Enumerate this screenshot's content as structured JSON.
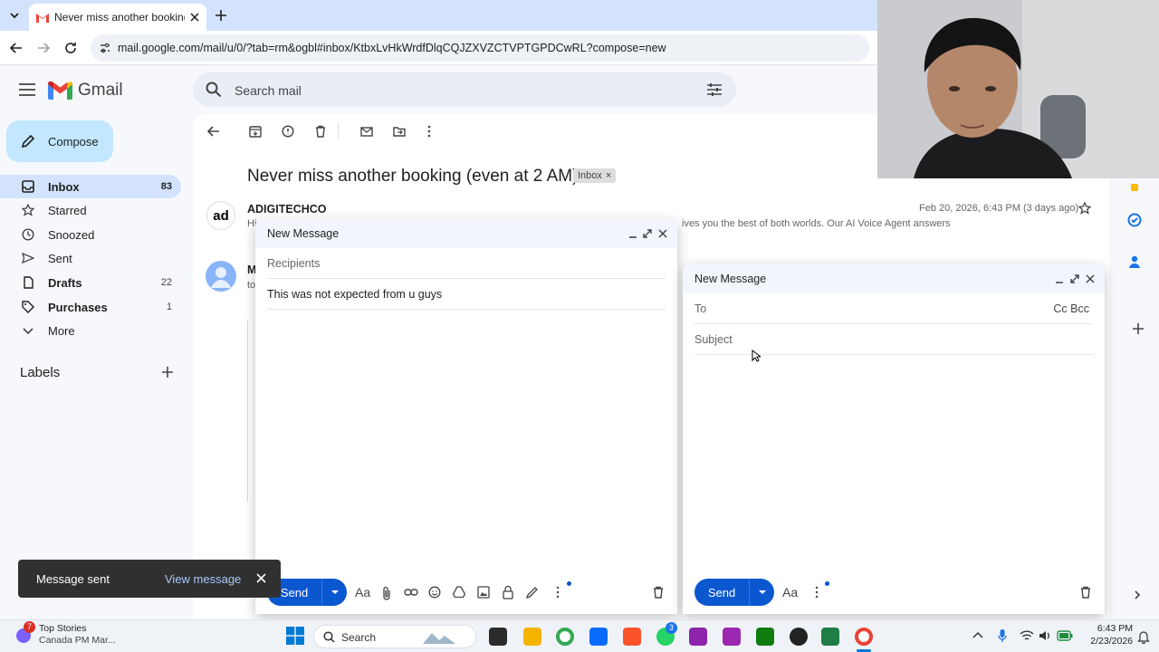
{
  "browser": {
    "tab_title": "Never miss another booking (e",
    "url": "mail.google.com/mail/u/0/?tab=rm&ogbl#inbox/KtbxLvHkWrdfDlqCQJZXVZCTVPTGPDCwRL?compose=new"
  },
  "gmail": {
    "brand": "Gmail",
    "search_placeholder": "Search mail",
    "compose_label": "Compose",
    "nav": [
      {
        "label": "Inbox",
        "count": "83",
        "icon": "inbox-icon"
      },
      {
        "label": "Starred",
        "count": "",
        "icon": "star-icon"
      },
      {
        "label": "Snoozed",
        "count": "",
        "icon": "clock-icon"
      },
      {
        "label": "Sent",
        "count": "",
        "icon": "send-icon"
      },
      {
        "label": "Drafts",
        "count": "22",
        "icon": "draft-icon"
      },
      {
        "label": "Purchases",
        "count": "1",
        "icon": "tag-icon"
      },
      {
        "label": "More",
        "count": "",
        "icon": "chevron-down-icon"
      }
    ],
    "labels_heading": "Labels",
    "email": {
      "subject": "Never miss another booking (even at 2 AM)",
      "label_chip": "Inbox",
      "sender": "ADIGITECHCO",
      "avatar_text": "ad",
      "date": "Feb 20, 2026, 6:43 PM (3 days ago)",
      "snippet_visible": "ives you the best of both worlds. Our AI Voice Agent answers",
      "snippet_start": "Hi",
      "second_sender_initial": "M",
      "second_to": "to"
    }
  },
  "compose1": {
    "title": "New Message",
    "recipients_placeholder": "Recipients",
    "subject_value": "This was not expected from u guys",
    "send_label": "Send"
  },
  "compose2": {
    "title": "New Message",
    "to_label": "To",
    "cc_bcc": "Cc Bcc",
    "subject_placeholder": "Subject",
    "send_label": "Send"
  },
  "toast": {
    "message": "Message sent",
    "action": "View message"
  },
  "taskbar": {
    "news_title": "Top Stories",
    "news_sub": "Canada PM Mar...",
    "news_badge": "7",
    "search_label": "Search",
    "time": "6:43 PM",
    "date": "2/23/2026",
    "whatsapp_badge": "3"
  },
  "colors": {
    "accent": "#0b57d0",
    "nav_active": "#d3e3fd",
    "compose_bg": "#c2e7ff",
    "toast_bg": "#303030"
  }
}
